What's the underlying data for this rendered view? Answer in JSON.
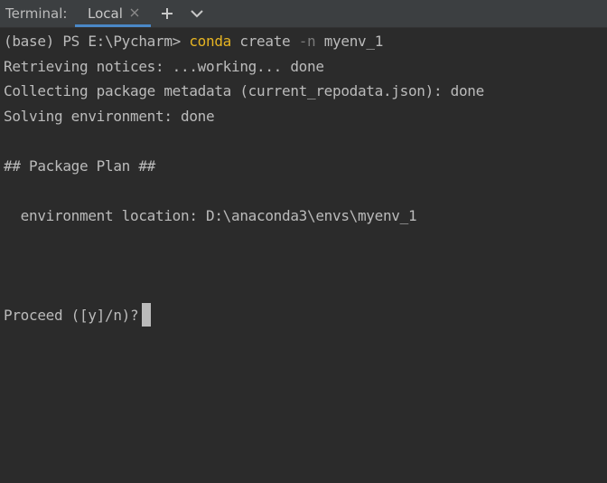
{
  "header": {
    "title": "Terminal:",
    "tabs": [
      {
        "label": "Local",
        "active": true,
        "close_icon": "close-icon"
      }
    ],
    "new_tab_icon": "plus-icon",
    "dropdown_icon": "chevron-down-icon"
  },
  "terminal": {
    "prompt": "(base) PS E:\\Pycharm>",
    "command": {
      "program": "conda",
      "subcommand": "create",
      "flag": "-n",
      "argument": "myenv_1"
    },
    "output": [
      "Retrieving notices: ...working... done",
      "Collecting package metadata (current_repodata.json): done",
      "Solving environment: done",
      "## Package Plan ##",
      "  environment location: D:\\anaconda3\\envs\\myenv_1"
    ],
    "input_prompt": "Proceed ([y]/n)?"
  },
  "colors": {
    "background": "#2b2b2b",
    "header_background": "#3c3f41",
    "text": "#bbbbbb",
    "command_highlight": "#e6b422",
    "flag": "#7a7a7a",
    "tab_underline": "#4a88c7"
  }
}
